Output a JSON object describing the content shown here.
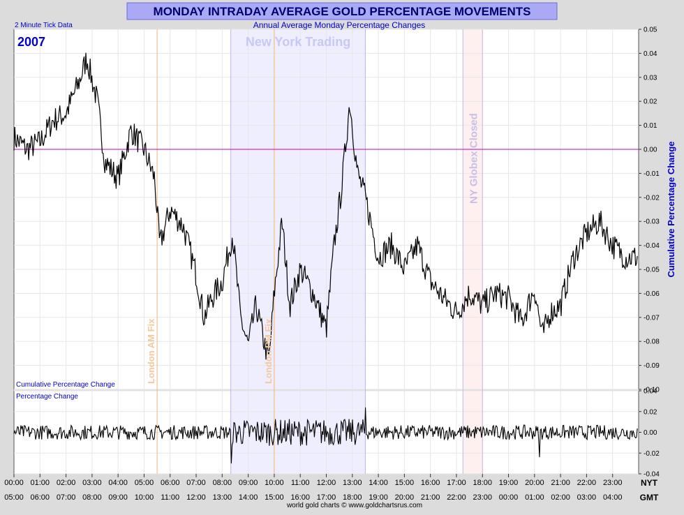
{
  "title": "MONDAY INTRADAY AVERAGE GOLD PERCENTAGE MOVEMENTS",
  "subtitle": "Annual Average Monday Percentage Changes",
  "tick_note": "2 Minute Tick Data",
  "year_label": "2007",
  "upper_panel_label": "Cumulative Percentage Change",
  "lower_panel_label": "Percentage Change",
  "right_axis_label": "Cumulative Percentage Change",
  "credit": "world gold charts © www.goldchartsrus.com",
  "timezone_top": "NYT",
  "timezone_bottom": "GMT",
  "annotations": {
    "ny_trading": "New York Trading",
    "london_am_fix": "London AM Fix",
    "london_pm_fix": "London PM Fix",
    "ny_globex_closed": "NY Globex Closed"
  },
  "colors": {
    "title_band": "#a9a9f5",
    "title_text": "#00006e",
    "accent_blue": "#0000cc",
    "ny_shade": "#eeeeff",
    "globex_shade": "#fff0f0",
    "fix_line": "#f4b47a",
    "zero_line": "#c000c0",
    "series": "#000000"
  },
  "chart_data": [
    {
      "type": "line",
      "name": "cumulative",
      "ylim": [
        -0.1,
        0.05
      ],
      "yticks": [
        "0.05",
        "0.04",
        "0.03",
        "0.02",
        "0.01",
        "0.00",
        "-0.01",
        "-0.02",
        "-0.03",
        "-0.04",
        "-0.05",
        "-0.06",
        "-0.07",
        "-0.08",
        "-0.09",
        "-0.10"
      ],
      "x_ticks_nyt": [
        "00:00",
        "01:00",
        "02:00",
        "03:00",
        "04:00",
        "05:00",
        "06:00",
        "07:00",
        "08:00",
        "09:00",
        "10:00",
        "11:00",
        "12:00",
        "13:00",
        "14:00",
        "15:00",
        "16:00",
        "17:00",
        "18:00",
        "19:00",
        "20:00",
        "21:00",
        "22:00",
        "23:00"
      ],
      "x_ticks_gmt": [
        "05:00",
        "06:00",
        "07:00",
        "08:00",
        "09:00",
        "10:00",
        "11:00",
        "12:00",
        "13:00",
        "14:00",
        "15:00",
        "16:00",
        "17:00",
        "18:00",
        "19:00",
        "20:00",
        "21:00",
        "22:00",
        "23:00",
        "00:00",
        "01:00",
        "02:00",
        "03:00",
        "04:00"
      ],
      "x_hours": [
        0,
        0.5,
        1,
        1.5,
        2,
        2.5,
        2.8,
        3.2,
        3.5,
        4,
        4.5,
        5,
        5.4,
        5.6,
        6,
        6.5,
        7,
        7.3,
        7.6,
        8,
        8.4,
        8.7,
        9,
        9.3,
        9.6,
        9.8,
        10,
        10.3,
        10.6,
        11,
        11.5,
        12,
        12.3,
        12.6,
        12.9,
        13.2,
        13.5,
        14,
        14.5,
        15,
        15.5,
        16,
        16.5,
        17,
        17.5,
        18,
        18.5,
        19,
        19.5,
        20,
        20.3,
        20.6,
        21,
        21.5,
        22,
        22.5,
        23,
        23.5,
        23.95
      ],
      "values": [
        0.005,
        0.0,
        0.003,
        0.012,
        0.015,
        0.028,
        0.038,
        0.02,
        -0.005,
        -0.012,
        0.008,
        0.0,
        -0.012,
        -0.04,
        -0.025,
        -0.032,
        -0.052,
        -0.07,
        -0.062,
        -0.055,
        -0.035,
        -0.07,
        -0.082,
        -0.065,
        -0.08,
        -0.088,
        -0.06,
        -0.03,
        -0.065,
        -0.05,
        -0.06,
        -0.075,
        -0.04,
        -0.015,
        0.02,
        -0.01,
        -0.02,
        -0.045,
        -0.04,
        -0.05,
        -0.04,
        -0.055,
        -0.062,
        -0.068,
        -0.06,
        -0.065,
        -0.06,
        -0.062,
        -0.072,
        -0.058,
        -0.078,
        -0.068,
        -0.065,
        -0.045,
        -0.035,
        -0.03,
        -0.04,
        -0.045,
        -0.045
      ],
      "fix_hours": {
        "london_am_fix": 5.5,
        "london_pm_fix": 10.0
      },
      "ny_trading_hours": [
        8.33,
        13.5
      ],
      "globex_closed_hours": [
        17.25,
        18.0
      ]
    },
    {
      "type": "line",
      "name": "percentage-change",
      "ylim": [
        -0.04,
        0.04
      ],
      "yticks": [
        "0.04",
        "0.02",
        "0.00",
        "-0.02",
        "-0.04"
      ],
      "x_hours": [
        0,
        1,
        2,
        3,
        4,
        5,
        6,
        7,
        8,
        8.35,
        9,
        10,
        11,
        12,
        13,
        13.5,
        14,
        15,
        16,
        17,
        18,
        19,
        20,
        20.2,
        21,
        22,
        23,
        23.95
      ],
      "values": [
        0.0,
        0.008,
        -0.008,
        0.01,
        -0.009,
        0.009,
        -0.01,
        0.008,
        -0.01,
        -0.03,
        0.015,
        -0.014,
        0.015,
        -0.014,
        0.015,
        0.024,
        -0.012,
        0.008,
        -0.008,
        0.01,
        -0.008,
        0.006,
        -0.01,
        -0.024,
        0.008,
        0.01,
        -0.008,
        0.005
      ]
    }
  ]
}
